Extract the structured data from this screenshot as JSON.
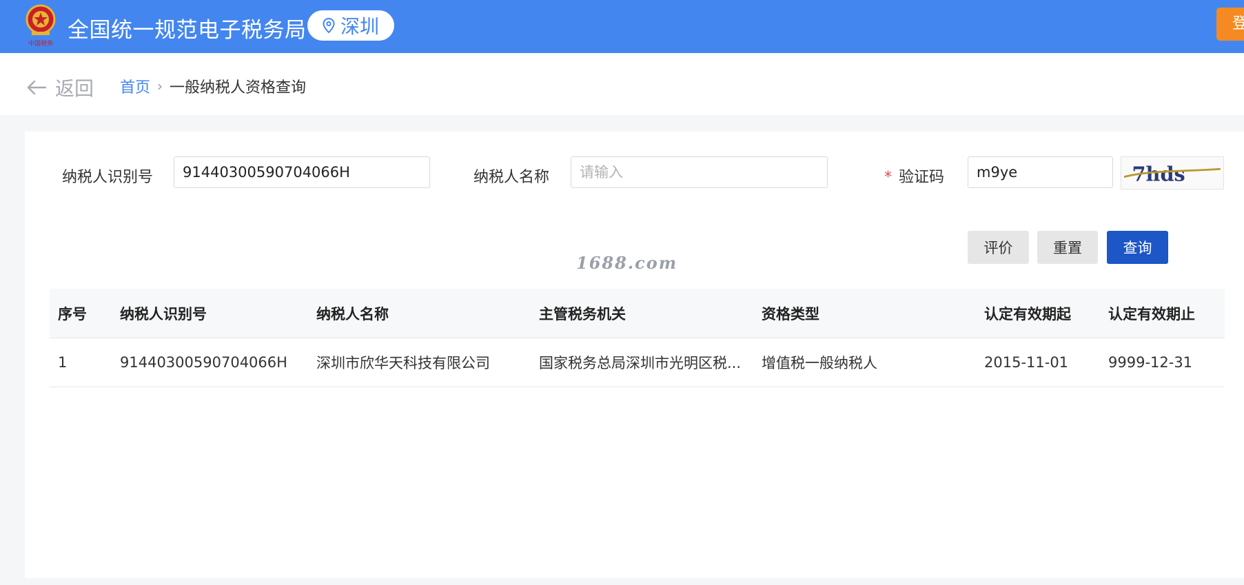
{
  "header": {
    "emblem_text": "中国税务",
    "title": "全国统一规范电子税务局",
    "region": "深圳",
    "login_label": "登录",
    "colors": {
      "bar": "#4386f0",
      "login": "#f58a22"
    }
  },
  "breadcrumb": {
    "back_label": "返回",
    "home": "首页",
    "current": "一般纳税人资格查询"
  },
  "form": {
    "taxpayer_id_label": "纳税人识别号",
    "taxpayer_id_value": "91440300590704066H",
    "taxpayer_name_label": "纳税人名称",
    "taxpayer_name_placeholder": "请输入",
    "captcha_required_mark": "*",
    "captcha_label": "验证码",
    "captcha_value": "m9ye",
    "captcha_image_text": "7hds"
  },
  "buttons": {
    "evaluate": "评价",
    "reset": "重置",
    "query": "查询"
  },
  "watermark": "1688.com",
  "table": {
    "headers": [
      "序号",
      "纳税人识别号",
      "纳税人名称",
      "主管税务机关",
      "资格类型",
      "认定有效期起",
      "认定有效期止"
    ],
    "rows": [
      [
        "1",
        "91440300590704066H",
        "深圳市欣华天科技有限公司",
        "国家税务总局深圳市光明区税...",
        "增值税一般纳税人",
        "2015-11-01",
        "9999-12-31"
      ]
    ]
  }
}
